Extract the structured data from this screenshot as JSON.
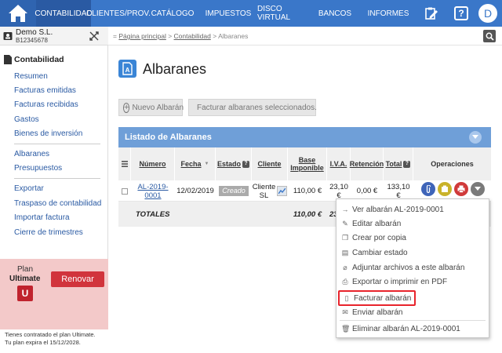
{
  "nav": {
    "items": [
      {
        "label": "CONTABILIDAD",
        "active": true
      },
      {
        "label": "CLIENTES/PROV."
      },
      {
        "label": "CATÁLOGO"
      },
      {
        "label": "IMPUESTOS"
      },
      {
        "label": "DISCO VIRTUAL"
      },
      {
        "label": "BANCOS"
      },
      {
        "label": "INFORMES"
      }
    ],
    "avatar_letter": "D",
    "help_symbol": "?"
  },
  "company": {
    "name": "Demo S.L.",
    "id": "B12345678"
  },
  "sidebar": {
    "section_title": "Contabilidad",
    "group1": [
      "Resumen",
      "Facturas emitidas",
      "Facturas recibidas",
      "Gastos",
      "Bienes de inversión"
    ],
    "group2": [
      "Albaranes",
      "Presupuestos"
    ],
    "group3": [
      "Exportar",
      "Traspaso de contabilidad",
      "Importar factura",
      "Cierre de trimestres"
    ]
  },
  "plan": {
    "label": "Plan",
    "name": "Ultimate",
    "badge_letter": "U",
    "renew_label": "Renovar",
    "footer_line1": "Tienes contratado el plan Ultimate.",
    "footer_line2": "Tu plan expira el 15/12/2028."
  },
  "breadcrumb": {
    "prefix": "=",
    "home": "Página principal",
    "sep": ">",
    "section": "Contabilidad",
    "current": "Albaranes"
  },
  "page": {
    "title": "Albaranes",
    "new_button": "Nuevo Albarán",
    "invoice_selected_button": "Facturar albaranes seleccionados."
  },
  "table": {
    "panel_title": "Listado de Albaranes",
    "headers": {
      "number": "Número",
      "date": "Fecha",
      "status": "Estado",
      "client": "Cliente",
      "base_line1": "Base",
      "base_line2": "Imponible",
      "iva": "I.V.A.",
      "retention": "Retención",
      "total": "Total",
      "operations": "Operaciones"
    },
    "row": {
      "number_line1": "AL-2019-",
      "number_line2": "0001",
      "date": "12/02/2019",
      "status": "Creado",
      "client_line1": "Cliente",
      "client_line2": "SL",
      "base": "110,00 €",
      "iva_line1": "23,10",
      "iva_line2": "€",
      "retention": "0,00 €",
      "total_line1": "133,10",
      "total_line2": "€"
    },
    "totals": {
      "label": "TOTALES",
      "base": "110,00 €",
      "iva_partial": "23"
    }
  },
  "menu": {
    "items": [
      {
        "icon": "arrow-right-icon",
        "label": "Ver albarán AL-2019-0001"
      },
      {
        "icon": "pencil-icon",
        "label": "Editar albarán"
      },
      {
        "icon": "copy-icon",
        "label": "Crear por copia"
      },
      {
        "icon": "status-icon",
        "label": "Cambiar estado"
      },
      {
        "icon": "paperclip-icon",
        "label": "Adjuntar archivos a este albarán"
      },
      {
        "icon": "printer-icon",
        "label": "Exportar o imprimir en PDF"
      },
      {
        "icon": "invoice-icon",
        "label": "Facturar albarán"
      },
      {
        "icon": "envelope-icon",
        "label": "Enviar albarán"
      },
      {
        "icon": "trash-icon",
        "label": "Eliminar albarán AL-2019-0001"
      }
    ],
    "highlight_color": "#e8242c"
  }
}
